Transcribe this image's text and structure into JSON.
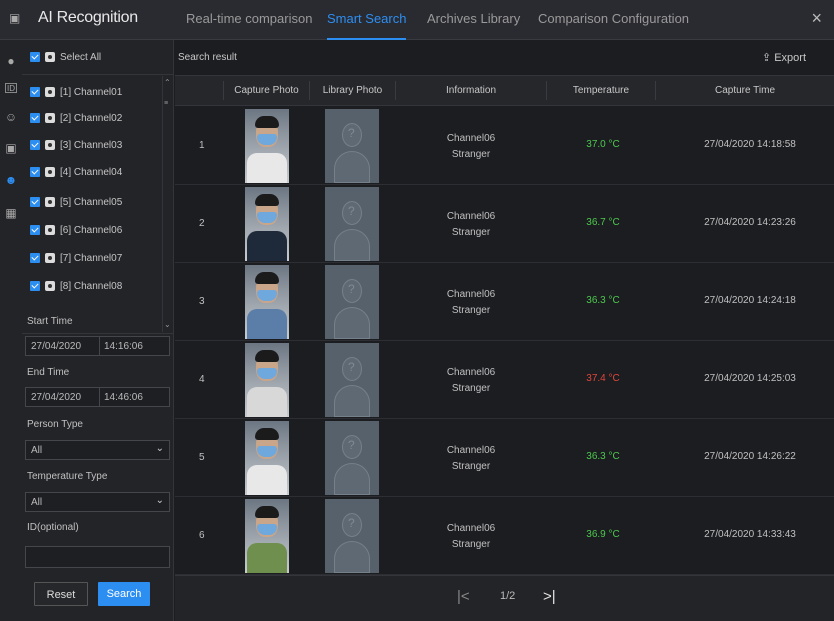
{
  "app": {
    "title": "AI Recognition",
    "close": "×"
  },
  "tabs": [
    {
      "label": "Real-time comparison"
    },
    {
      "label": "Smart Search"
    },
    {
      "label": "Archives Library"
    },
    {
      "label": "Comparison Configuration"
    }
  ],
  "active_tab": "Smart Search",
  "sidebar": {
    "select_all": "Select All",
    "channels": [
      {
        "label": "[1] Channel01"
      },
      {
        "label": "[2] Channel02"
      },
      {
        "label": "[3] Channel03"
      },
      {
        "label": "[4] Channel04"
      },
      {
        "label": "[5] Channel05"
      },
      {
        "label": "[6] Channel06"
      },
      {
        "label": "[7] Channel07"
      },
      {
        "label": "[8] Channel08"
      }
    ],
    "start_time_label": "Start Time",
    "start_date": "27/04/2020",
    "start_time": "14:16:06",
    "end_time_label": "End Time",
    "end_date": "27/04/2020",
    "end_time": "14:46:06",
    "person_type_label": "Person Type",
    "person_type_value": "All",
    "temperature_type_label": "Temperature Type",
    "temperature_type_value": "All",
    "id_label": "ID(optional)",
    "id_value": "",
    "reset_label": "Reset",
    "search_label": "Search"
  },
  "main": {
    "result_label": "Search result",
    "export_label": "Export",
    "columns": [
      "Capture Photo",
      "Library Photo",
      "Information",
      "Temperature",
      "Capture Time"
    ],
    "rows": [
      {
        "index": "1",
        "channel": "Channel06",
        "type": "Stranger",
        "temperature": "37.0 °C",
        "time": "27/04/2020 14:18:58",
        "temp_color": "#4cc94c"
      },
      {
        "index": "2",
        "channel": "Channel06",
        "type": "Stranger",
        "temperature": "36.7 °C",
        "time": "27/04/2020 14:23:26",
        "temp_color": "#4cc94c"
      },
      {
        "index": "3",
        "channel": "Channel06",
        "type": "Stranger",
        "temperature": "36.3 °C",
        "time": "27/04/2020 14:24:18",
        "temp_color": "#4cc94c"
      },
      {
        "index": "4",
        "channel": "Channel06",
        "type": "Stranger",
        "temperature": "37.4 °C",
        "time": "27/04/2020 14:25:03",
        "temp_color": "#e0463a"
      },
      {
        "index": "5",
        "channel": "Channel06",
        "type": "Stranger",
        "temperature": "36.3 °C",
        "time": "27/04/2020 14:26:22",
        "temp_color": "#4cc94c"
      },
      {
        "index": "6",
        "channel": "Channel06",
        "type": "Stranger",
        "temperature": "36.9 °C",
        "time": "27/04/2020 14:33:43",
        "temp_color": "#4cc94c"
      }
    ],
    "pager": {
      "page_info": "1/2"
    }
  },
  "colors": {
    "accent": "#2d8ef2",
    "normal_temp": "#4cc94c",
    "high_temp": "#e0463a"
  }
}
